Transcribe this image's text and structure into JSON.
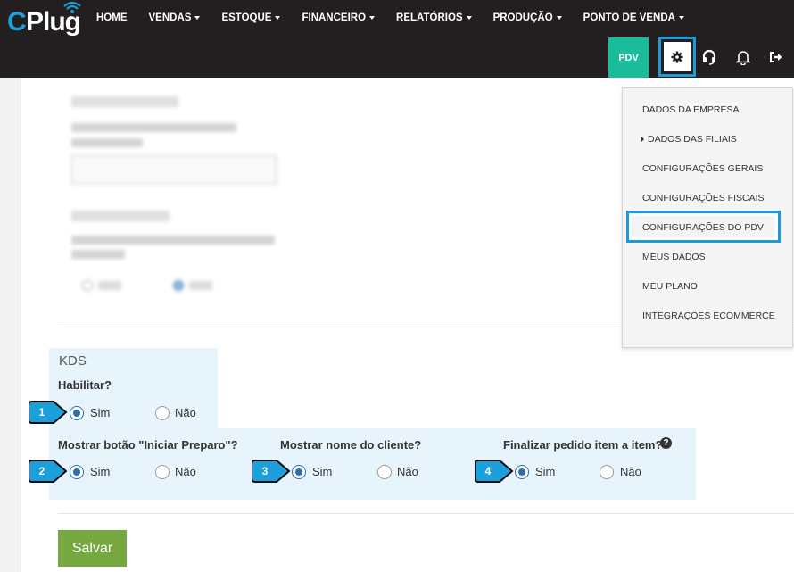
{
  "brand": {
    "logo_c": "C",
    "logo_rest": "Plug"
  },
  "nav": {
    "items": [
      {
        "label": "HOME",
        "caret": false
      },
      {
        "label": "VENDAS",
        "caret": true
      },
      {
        "label": "ESTOQUE",
        "caret": true
      },
      {
        "label": "FINANCEIRO",
        "caret": true
      },
      {
        "label": "RELATÓRIOS",
        "caret": true
      },
      {
        "label": "PRODUÇÃO",
        "caret": true
      },
      {
        "label": "PONTO DE VENDA",
        "caret": true
      }
    ],
    "pdv_label": "PDV"
  },
  "dropdown": {
    "items": [
      {
        "label": "DADOS DA EMPRESA"
      },
      {
        "label": "DADOS DAS FILIAIS"
      },
      {
        "label": "CONFIGURAÇÕES GERAIS"
      },
      {
        "label": "CONFIGURAÇÕES FISCAIS"
      },
      {
        "label": "CONFIGURAÇÕES DO PDV"
      },
      {
        "label": "MEUS DADOS"
      },
      {
        "label": "MEU PLANO"
      },
      {
        "label": "INTEGRAÇÕES ECOMMERCE"
      }
    ],
    "highlighted_index": 4
  },
  "kds": {
    "title": "KDS",
    "habilitar": {
      "label": "Habilitar?",
      "yes": "Sim",
      "no": "Não",
      "selected": "Sim",
      "marker": "1"
    },
    "botao_iniciar": {
      "label": "Mostrar botão \"Iniciar Preparo\"?",
      "yes": "Sim",
      "no": "Não",
      "selected": "Sim",
      "marker": "2"
    },
    "nome_cliente": {
      "label": "Mostrar nome do cliente?",
      "yes": "Sim",
      "no": "Não",
      "selected": "Sim",
      "marker": "3"
    },
    "finalizar_item": {
      "label": "Finalizar pedido item a item?",
      "yes": "Sim",
      "no": "Não",
      "selected": "Sim",
      "marker": "4",
      "help": "?"
    }
  },
  "actions": {
    "save_label": "Salvar"
  },
  "colors": {
    "topbar": "#231f20",
    "pdv": "#1abc9c",
    "highlight": "#1e9ad6",
    "kds_bg": "#e8f4fb",
    "save": "#75a93f",
    "marker": "#1ca0dc"
  }
}
